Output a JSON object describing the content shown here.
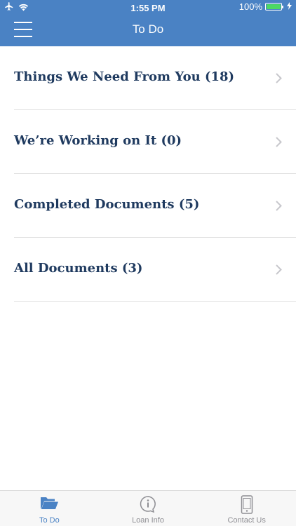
{
  "status_bar": {
    "time": "1:55 PM",
    "battery_percent": "100%",
    "battery_level": 1.0,
    "icons": [
      "airplane-icon",
      "wifi-icon",
      "battery-icon",
      "charging-icon"
    ]
  },
  "header": {
    "title": "To Do",
    "menu_icon": "hamburger-menu-icon"
  },
  "list": {
    "items": [
      {
        "label": "Things We Need From You (18)"
      },
      {
        "label": "We’re Working on It (0)"
      },
      {
        "label": "Completed Documents (5)"
      },
      {
        "label": "All Documents (3)"
      }
    ]
  },
  "tab_bar": {
    "tabs": [
      {
        "label": "To Do",
        "icon": "folder-open-icon",
        "active": true
      },
      {
        "label": "Loan Info",
        "icon": "info-bubble-icon",
        "active": false
      },
      {
        "label": "Contact Us",
        "icon": "phone-icon",
        "active": false
      }
    ]
  },
  "colors": {
    "header_bg": "#4a82c4",
    "item_text": "#1f3a5f",
    "chevron": "#c7c7cc",
    "tab_active": "#4a82c4",
    "tab_inactive": "#8e8e93"
  }
}
